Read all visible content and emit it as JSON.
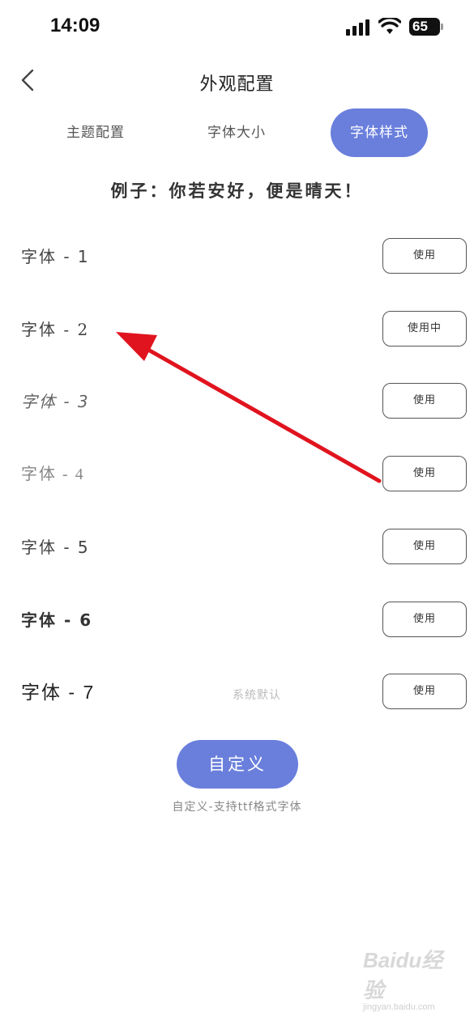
{
  "status_bar": {
    "time": "14:09",
    "battery": "65"
  },
  "nav": {
    "title": "外观配置"
  },
  "tabs": [
    {
      "label": "主题配置",
      "selected": false
    },
    {
      "label": "字体大小",
      "selected": false
    },
    {
      "label": "字体样式",
      "selected": true
    }
  ],
  "example_text": "例子：你若安好，便是晴天！",
  "fonts": [
    {
      "name": "字体 - 1",
      "button": "使用",
      "note": ""
    },
    {
      "name": "字体 - 2",
      "button": "使用中",
      "note": ""
    },
    {
      "name": "字体 - 3",
      "button": "使用",
      "note": ""
    },
    {
      "name": "字体 - 4",
      "button": "使用",
      "note": ""
    },
    {
      "name": "字体 - 5",
      "button": "使用",
      "note": ""
    },
    {
      "name": "字体 - 6",
      "button": "使用",
      "note": ""
    },
    {
      "name": "字体 - 7",
      "button": "使用",
      "note": "系统默认"
    }
  ],
  "custom": {
    "button": "自定义",
    "hint": "自定义-支持ttf格式字体"
  },
  "watermark": {
    "logo": "Baidu经验",
    "sub": "jingyan.baidu.com"
  },
  "colors": {
    "accent": "#6a7fdc",
    "arrow": "#e0141e"
  }
}
